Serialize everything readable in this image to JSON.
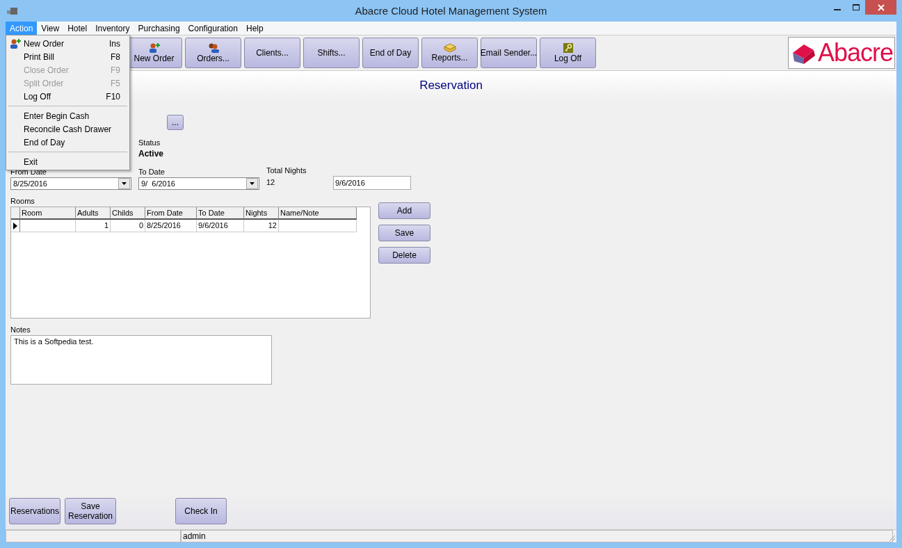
{
  "window": {
    "title": "Abacre Cloud Hotel Management System"
  },
  "menu_bar": [
    {
      "label": "Action",
      "selected": true
    },
    {
      "label": "View",
      "selected": false
    },
    {
      "label": "Hotel",
      "selected": false
    },
    {
      "label": "Inventory",
      "selected": false
    },
    {
      "label": "Purchasing",
      "selected": false
    },
    {
      "label": "Configuration",
      "selected": false
    },
    {
      "label": "Help",
      "selected": false
    }
  ],
  "action_menu": [
    {
      "kind": "item",
      "label": "New Order",
      "shortcut": "Ins",
      "disabled": false
    },
    {
      "kind": "item",
      "label": "Print Bill",
      "shortcut": "F8",
      "disabled": false
    },
    {
      "kind": "item",
      "label": "Close Order",
      "shortcut": "F9",
      "disabled": true
    },
    {
      "kind": "item",
      "label": "Split Order",
      "shortcut": "F5",
      "disabled": true
    },
    {
      "kind": "item",
      "label": "Log Off",
      "shortcut": "F10",
      "disabled": false
    },
    {
      "kind": "separator"
    },
    {
      "kind": "item",
      "label": "Enter Begin Cash",
      "disabled": false
    },
    {
      "kind": "item",
      "label": "Reconcile Cash Drawer",
      "disabled": false
    },
    {
      "kind": "item",
      "label": "End of Day",
      "disabled": false
    },
    {
      "kind": "separator"
    },
    {
      "kind": "item",
      "label": "Exit",
      "disabled": false
    }
  ],
  "toolbar": [
    "New Order",
    "Orders...",
    "Clients...",
    "Shifts...",
    "End of Day",
    "Reports...",
    "Email Sender...",
    "Log Off"
  ],
  "logo": {
    "text": "Abacre"
  },
  "page_title": "Reservation",
  "browse_button": "...",
  "status": {
    "label": "Status",
    "value": "Active"
  },
  "from_date": {
    "label": "From Date",
    "value": "8/25/2016"
  },
  "to_date": {
    "label": "To Date",
    "value": "9/  6/2016"
  },
  "total_nights": {
    "label": "Total Nights",
    "value": "12"
  },
  "date_field": {
    "value": "9/6/2016"
  },
  "rooms": {
    "label": "Rooms",
    "columns": [
      "Room",
      "Adults",
      "Childs",
      "From Date",
      "To Date",
      "Nights",
      "Name/Note"
    ],
    "rows": [
      {
        "current": true,
        "cells": [
          "",
          "1",
          "0",
          "8/25/2016",
          "9/6/2016",
          "12",
          ""
        ]
      }
    ]
  },
  "room_buttons": [
    "Add",
    "Save",
    "Delete"
  ],
  "notes": {
    "label": "Notes",
    "value": "This is a Softpedia test."
  },
  "bottom_buttons": [
    "Reservations",
    "Save Reservation",
    "Check In"
  ],
  "status_bar": {
    "user": "admin"
  }
}
